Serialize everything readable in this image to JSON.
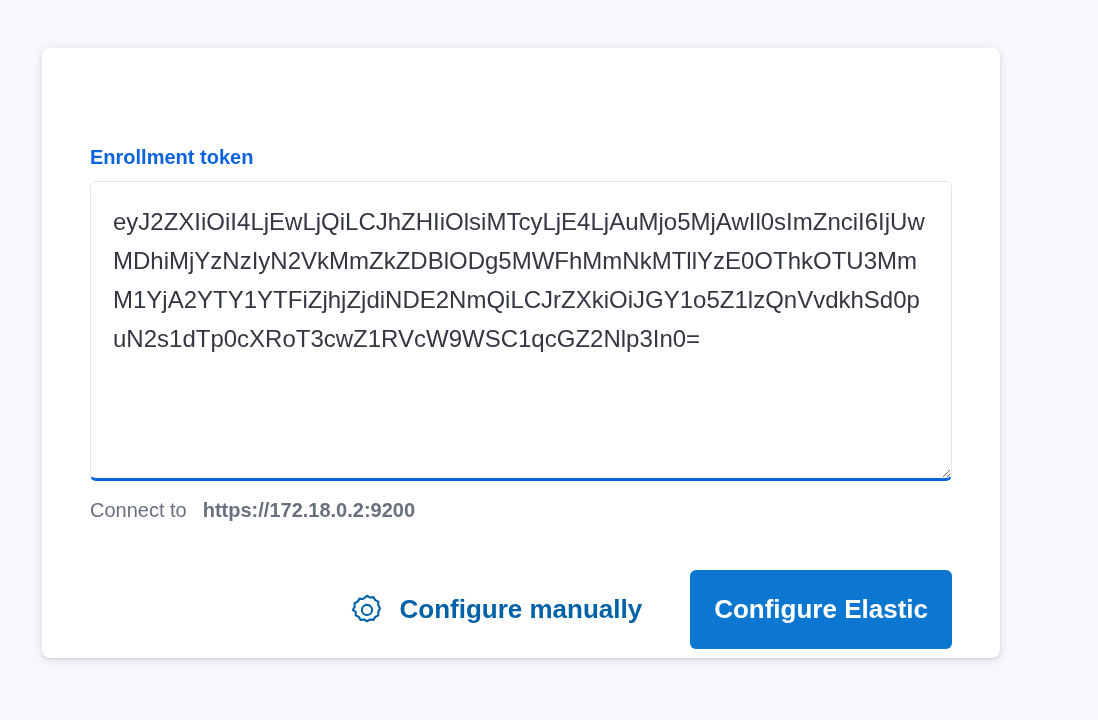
{
  "token_field": {
    "label": "Enrollment token",
    "value": "eyJ2ZXIiOiI4LjEwLjQiLCJhZHIiOlsiMTcyLjE4LjAuMjo5MjAwIl0sImZnciI6IjUwMDhiMjYzNzIyN2VkMmZkZDBlODg5MWFhMmNkMTllYzE0OThkOTU3MmM1YjA2YTY1YTFiZjhjZjdiNDE2NmQiLCJrZXkiOiJGY1o5Z1lzQnVvdkhSd0puN2s1dTp0cXRoT3cwZ1RVcW9WSC1qcGZ2Nlp3In0=",
    "focused": true
  },
  "connect": {
    "label": "Connect to",
    "address": "https://172.18.0.2:9200"
  },
  "actions": {
    "secondary": "Configure manually",
    "primary": "Configure Elastic"
  }
}
